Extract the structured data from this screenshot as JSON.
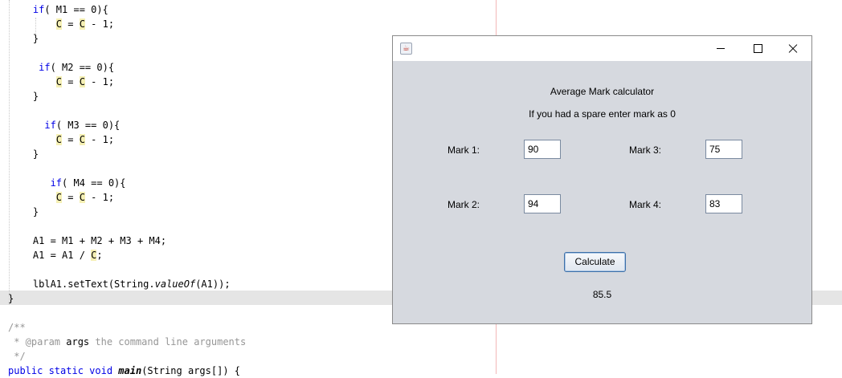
{
  "code": {
    "lines": [
      {
        "indent": "    ",
        "kw": "if",
        "rest": "( M1 == 0){"
      },
      {
        "indent": "        ",
        "v1": "C",
        "mid": " = ",
        "v2": "C",
        "tail": " - 1;"
      },
      {
        "text": "    }"
      },
      {
        "indent": "     ",
        "kw": "if",
        "rest": "( M2 == 0){"
      },
      {
        "indent": "        ",
        "v1": "C",
        "mid": " = ",
        "v2": "C",
        "tail": " - 1;"
      },
      {
        "text": "    }"
      },
      {
        "indent": "      ",
        "kw": "if",
        "rest": "( M3 == 0){"
      },
      {
        "indent": "        ",
        "v1": "C",
        "mid": " = ",
        "v2": "C",
        "tail": " - 1;"
      },
      {
        "text": "    }"
      },
      {
        "indent": "       ",
        "kw": "if",
        "rest": "( M4 == 0){"
      },
      {
        "indent": "        ",
        "v1": "C",
        "mid": " = ",
        "v2": "C",
        "tail": " - 1;"
      },
      {
        "text": "    }"
      },
      {
        "text": "    A1 = M1 + M2 + M3 + M4;"
      },
      {
        "pre": "    A1 = A1 / ",
        "v1": "C",
        "tail": ";"
      },
      {
        "pre": "    lblA1.setText(String.",
        "mth": "valueOf",
        "tail": "(A1));"
      },
      {
        "text": "}"
      },
      {
        "cmt": "/**"
      },
      {
        "cmt1": " * @param ",
        "param": "args",
        "cmt2": " the command line arguments"
      },
      {
        "cmt": " */"
      },
      {
        "kw": "public static void ",
        "mth": "main",
        "tail": "(String args[]) {"
      }
    ]
  },
  "window": {
    "icon": "java-app-icon",
    "minimize_icon": "minimize-icon",
    "maximize_icon": "maximize-icon",
    "close_icon": "close-icon",
    "heading": "Average Mark calculator",
    "subheading": "If you had a spare enter mark as 0",
    "mark1_label": "Mark 1:",
    "mark1_value": "90",
    "mark2_label": "Mark 2:",
    "mark2_value": "94",
    "mark3_label": "Mark 3:",
    "mark3_value": "75",
    "mark4_label": "Mark 4:",
    "mark4_value": "83",
    "calculate_label": "Calculate",
    "result": "85.5"
  }
}
